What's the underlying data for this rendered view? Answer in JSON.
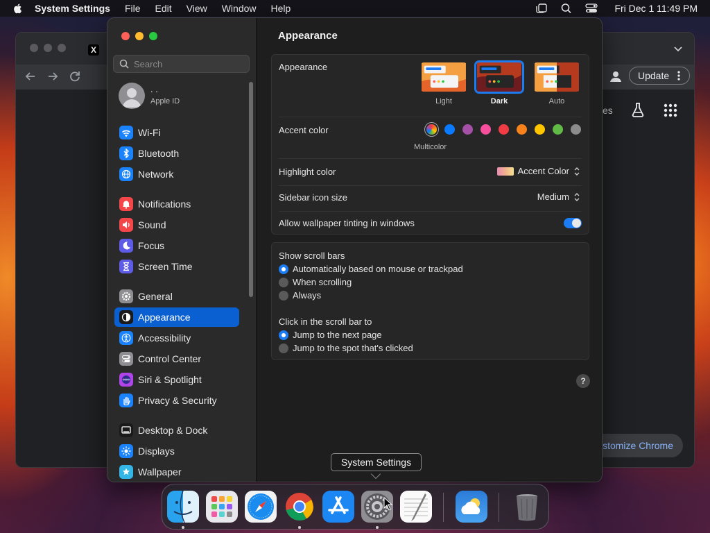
{
  "menubar": {
    "app_name": "System Settings",
    "menus": [
      "File",
      "Edit",
      "View",
      "Window",
      "Help"
    ],
    "clock": "Fri Dec 1  11:49 PM"
  },
  "chrome": {
    "tab_icon": "X",
    "update_label": "Update",
    "shortcut_fragment": "es",
    "customize_label": "Customize Chrome"
  },
  "settings": {
    "search_placeholder": "Search",
    "apple_id": {
      "name": ". .",
      "sub": "Apple ID"
    },
    "sidebar": [
      {
        "label": "Wi-Fi",
        "icon": "wifi-icon",
        "color": "#1a82fb"
      },
      {
        "label": "Bluetooth",
        "icon": "bluetooth-icon",
        "color": "#1a82fb"
      },
      {
        "label": "Network",
        "icon": "globe-icon",
        "color": "#1a82fb"
      },
      {
        "label": "Notifications",
        "icon": "bell-icon",
        "color": "#f4474a"
      },
      {
        "label": "Sound",
        "icon": "speaker-icon",
        "color": "#f4474a"
      },
      {
        "label": "Focus",
        "icon": "moon-icon",
        "color": "#5e5ce6"
      },
      {
        "label": "Screen Time",
        "icon": "hourglass-icon",
        "color": "#5e5ce6"
      },
      {
        "label": "General",
        "icon": "gear-icon",
        "color": "#8e8e93"
      },
      {
        "label": "Appearance",
        "icon": "appearance-icon",
        "color": "#1a1a1a"
      },
      {
        "label": "Accessibility",
        "icon": "accessibility-icon",
        "color": "#1a82fb"
      },
      {
        "label": "Control Center",
        "icon": "control-center-icon",
        "color": "#8e8e93"
      },
      {
        "label": "Siri & Spotlight",
        "icon": "siri-icon",
        "color": "#b044e8"
      },
      {
        "label": "Privacy & Security",
        "icon": "hand-icon",
        "color": "#1a82fb"
      },
      {
        "label": "Desktop & Dock",
        "icon": "desktop-icon",
        "color": "#1a1a1a"
      },
      {
        "label": "Displays",
        "icon": "sun-icon",
        "color": "#1a82fb"
      },
      {
        "label": "Wallpaper",
        "icon": "wallpaper-icon",
        "color": "#33b5e5"
      }
    ],
    "selected_item": "Appearance",
    "main": {
      "title": "Appearance",
      "appearance_label": "Appearance",
      "themes": [
        {
          "label": "Light",
          "selected": false
        },
        {
          "label": "Dark",
          "selected": true
        },
        {
          "label": "Auto",
          "selected": false
        }
      ],
      "accent_label": "Accent color",
      "accent_colors": [
        "multicolor",
        "#0a7aff",
        "#a550a7",
        "#f74f9e",
        "#f23c45",
        "#f7821b",
        "#ffc600",
        "#62ba46",
        "#8c8c8c"
      ],
      "accent_selected_label": "Multicolor",
      "highlight_label": "Highlight color",
      "highlight_value": "Accent Color",
      "sidebar_size_label": "Sidebar icon size",
      "sidebar_size_value": "Medium",
      "tinting_label": "Allow wallpaper tinting in windows",
      "tinting_on": true,
      "scrollbars_label": "Show scroll bars",
      "scrollbar_options": [
        {
          "label": "Automatically based on mouse or trackpad",
          "checked": true
        },
        {
          "label": "When scrolling",
          "checked": false
        },
        {
          "label": "Always",
          "checked": false
        }
      ],
      "click_label": "Click in the scroll bar to",
      "click_options": [
        {
          "label": "Jump to the next page",
          "checked": true
        },
        {
          "label": "Jump to the spot that's clicked",
          "checked": false
        }
      ],
      "help": "?"
    }
  },
  "tooltip": "System Settings",
  "dock": [
    "finder-icon",
    "launchpad-icon",
    "safari-icon",
    "chrome-icon",
    "app-store-icon",
    "system-settings-icon",
    "textedit-icon",
    "weather-icon",
    "trash-icon"
  ]
}
